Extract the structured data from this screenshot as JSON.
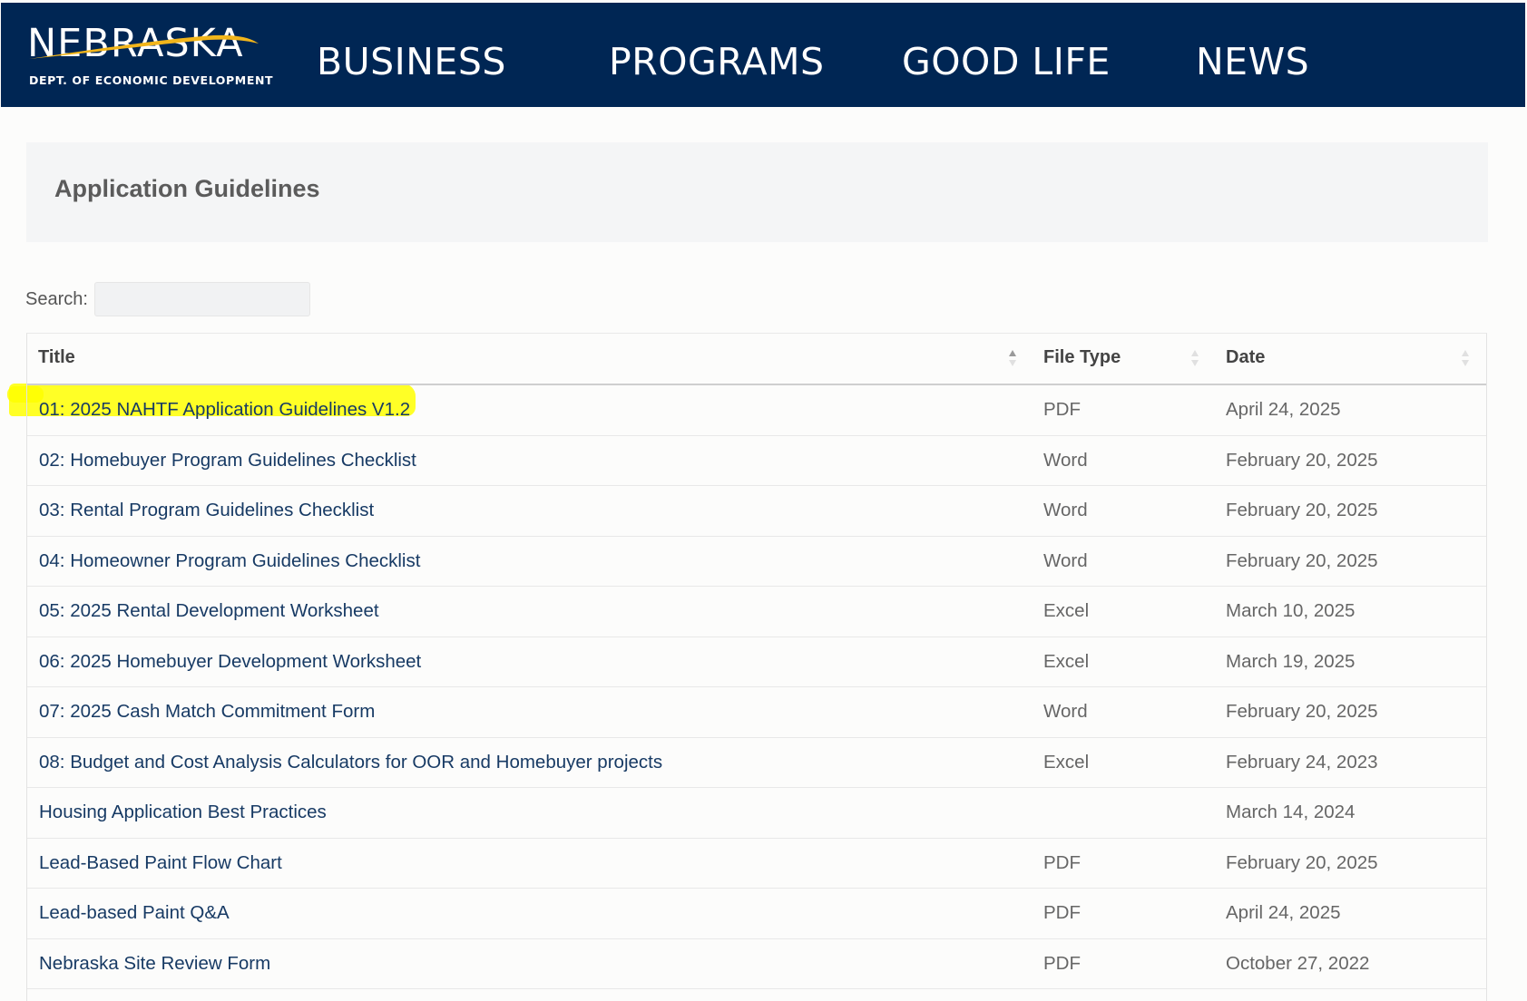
{
  "header": {
    "logo": {
      "wordmark": "NEBRASKA",
      "subtitle": "DEPT. OF ECONOMIC DEVELOPMENT",
      "swoosh_color": "#f2b51b"
    },
    "nav": [
      {
        "label": "BUSINESS"
      },
      {
        "label": "PROGRAMS"
      },
      {
        "label": "GOOD LIFE"
      },
      {
        "label": "NEWS"
      }
    ],
    "background_color": "#002654"
  },
  "page": {
    "title": "Application Guidelines"
  },
  "search": {
    "label": "Search:",
    "value": ""
  },
  "table": {
    "columns": [
      {
        "label": "Title",
        "sort": "ascending"
      },
      {
        "label": "File Type",
        "sort": "none"
      },
      {
        "label": "Date",
        "sort": "none"
      }
    ],
    "rows": [
      {
        "title": "01: 2025 NAHTF Application Guidelines V1.2",
        "type": "PDF",
        "date": "April 24, 2025",
        "highlighted": true
      },
      {
        "title": "02: Homebuyer Program Guidelines Checklist",
        "type": "Word",
        "date": "February 20, 2025"
      },
      {
        "title": "03: Rental Program Guidelines Checklist",
        "type": "Word",
        "date": "February 20, 2025"
      },
      {
        "title": "04: Homeowner Program Guidelines Checklist",
        "type": "Word",
        "date": "February 20, 2025"
      },
      {
        "title": "05: 2025 Rental Development Worksheet",
        "type": "Excel",
        "date": "March 10, 2025"
      },
      {
        "title": "06: 2025 Homebuyer Development Worksheet",
        "type": "Excel",
        "date": "March 19, 2025"
      },
      {
        "title": "07: 2025 Cash Match Commitment Form",
        "type": "Word",
        "date": "February 20, 2025"
      },
      {
        "title": "08: Budget and Cost Analysis Calculators for OOR and Homebuyer projects",
        "type": "Excel",
        "date": "February 24, 2023"
      },
      {
        "title": "Housing Application Best Practices",
        "type": "",
        "date": "March 14, 2024"
      },
      {
        "title": "Lead-Based Paint Flow Chart",
        "type": "PDF",
        "date": "February 20, 2025"
      },
      {
        "title": "Lead-based Paint Q&A",
        "type": "PDF",
        "date": "April 24, 2025"
      },
      {
        "title": "Nebraska Site Review Form",
        "type": "PDF",
        "date": "October 27, 2022"
      }
    ],
    "link_color": "#173a64",
    "highlight_color": "#ffff00"
  }
}
